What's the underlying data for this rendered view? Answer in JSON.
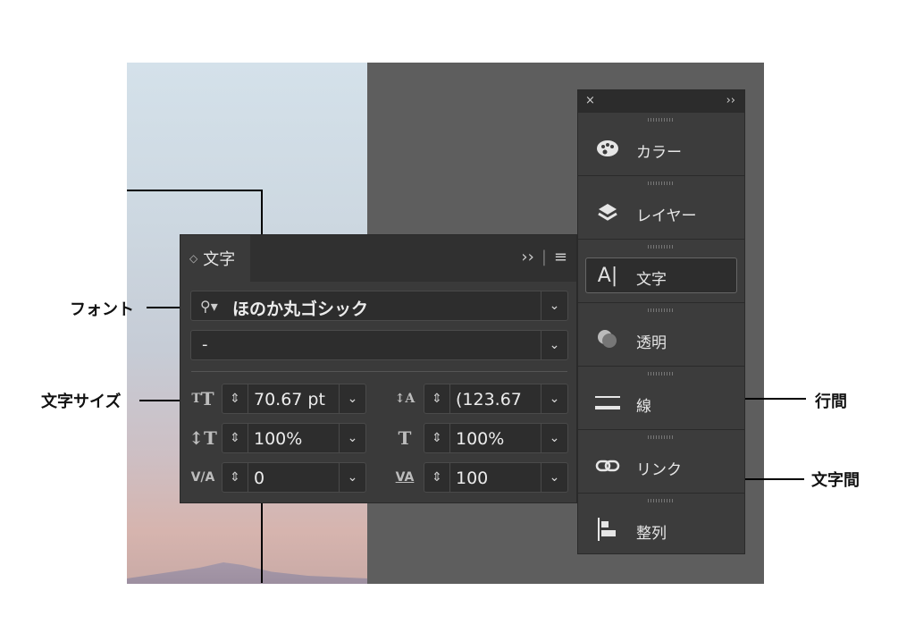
{
  "panel": {
    "tab_label": "文字",
    "tab_updown": "◇",
    "expand_icon": "››",
    "menu_icon": "≡",
    "font_family": "ほのか丸ゴシック",
    "font_style": "-",
    "font_size": "70.67 pt",
    "leading": "(123.67",
    "vertical_scale": "100%",
    "horizontal_scale": "100%",
    "kerning": "0",
    "tracking": "100"
  },
  "dock": {
    "close": "×",
    "collapse": "››",
    "items": [
      {
        "label": "カラー",
        "icon": "palette-icon"
      },
      {
        "label": "レイヤー",
        "icon": "layers-icon"
      },
      {
        "label": "文字",
        "icon": "type-icon"
      },
      {
        "label": "透明",
        "icon": "transparency-icon"
      },
      {
        "label": "線",
        "icon": "stroke-icon"
      },
      {
        "label": "リンク",
        "icon": "link-icon"
      },
      {
        "label": "整列",
        "icon": "align-icon"
      }
    ]
  },
  "callouts": {
    "font": "フォント",
    "font_size": "文字サイズ",
    "leading": "行間",
    "tracking": "文字間"
  }
}
